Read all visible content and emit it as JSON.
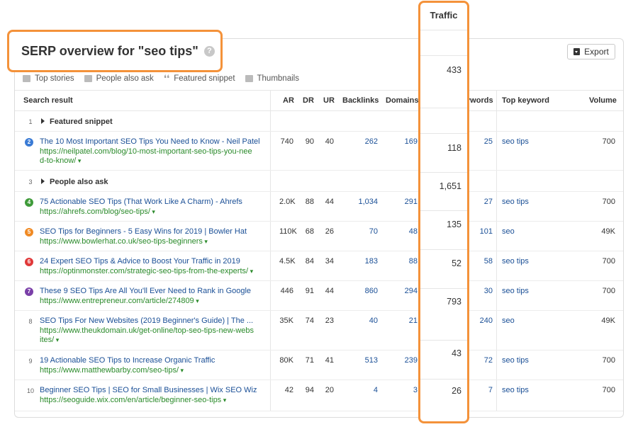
{
  "title": "SERP overview for \"seo tips\"",
  "help_icon": "?",
  "export_label": "Export",
  "filters": [
    "Top stories",
    "People also ask",
    "Featured snippet",
    "Thumbnails"
  ],
  "columns": {
    "search_result": "Search result",
    "ar": "AR",
    "dr": "DR",
    "ur": "UR",
    "backlinks": "Backlinks",
    "domains": "Domains",
    "keywords": "Keywords",
    "top_keyword": "Top keyword",
    "volume": "Volume"
  },
  "traffic_header": "Traffic",
  "sections": {
    "featured_rank": "1",
    "featured_label": "Featured snippet",
    "paa_rank": "3",
    "paa_label": "People also ask"
  },
  "rows": [
    {
      "rank": "2",
      "badge_color": "#3a7bd5",
      "title": "The 10 Most Important SEO Tips You Need to Know - Neil Patel",
      "url1": "https://neilpatel.com/blog/10-most-important-seo-tips-you-nee",
      "url2": "d-to-know/",
      "ar": "740",
      "dr": "90",
      "ur": "40",
      "backlinks": "262",
      "domains": "169",
      "traffic": "118",
      "keywords": "25",
      "top_keyword": "seo tips",
      "volume": "700"
    },
    {
      "rank": "4",
      "badge_color": "#3f9b3a",
      "title": "75 Actionable SEO Tips (That Work Like A Charm) - Ahrefs",
      "url1": "https://ahrefs.com/blog/seo-tips/",
      "url2": "",
      "ar": "2.0K",
      "dr": "88",
      "ur": "44",
      "backlinks": "1,034",
      "domains": "291",
      "traffic": "1,651",
      "keywords": "27",
      "top_keyword": "seo tips",
      "volume": "700"
    },
    {
      "rank": "5",
      "badge_color": "#f08a24",
      "title": "SEO Tips for Beginners - 5 Easy Wins for 2019 | Bowler Hat",
      "url1": "https://www.bowlerhat.co.uk/seo-tips-beginners",
      "url2": "",
      "ar": "110K",
      "dr": "68",
      "ur": "26",
      "backlinks": "70",
      "domains": "48",
      "traffic": "135",
      "keywords": "101",
      "top_keyword": "seo",
      "volume": "49K"
    },
    {
      "rank": "6",
      "badge_color": "#e0393a",
      "title": "24 Expert SEO Tips & Advice to Boost Your Traffic in 2019",
      "url1": "https://optinmonster.com/strategic-seo-tips-from-the-experts/",
      "url2": "",
      "ar": "4.5K",
      "dr": "84",
      "ur": "34",
      "backlinks": "183",
      "domains": "88",
      "traffic": "52",
      "keywords": "58",
      "top_keyword": "seo tips",
      "volume": "700"
    },
    {
      "rank": "7",
      "badge_color": "#7a3fa8",
      "title": "These 9 SEO Tips Are All You'll Ever Need to Rank in Google",
      "url1": "https://www.entrepreneur.com/article/274809",
      "url2": "",
      "ar": "446",
      "dr": "91",
      "ur": "44",
      "backlinks": "860",
      "domains": "294",
      "traffic": "793",
      "keywords": "30",
      "top_keyword": "seo tips",
      "volume": "700"
    },
    {
      "rank": "8",
      "badge_color": "",
      "title": "SEO Tips For New Websites (2019 Beginner's Guide) | The ...",
      "url1": "https://www.theukdomain.uk/get-online/top-seo-tips-new-webs",
      "url2": "ites/",
      "ar": "35K",
      "dr": "74",
      "ur": "23",
      "backlinks": "40",
      "domains": "21",
      "traffic": "43",
      "keywords": "240",
      "top_keyword": "seo",
      "volume": "49K"
    },
    {
      "rank": "9",
      "badge_color": "",
      "title": "19 Actionable SEO Tips to Increase Organic Traffic",
      "url1": "https://www.matthewbarby.com/seo-tips/",
      "url2": "",
      "ar": "80K",
      "dr": "71",
      "ur": "41",
      "backlinks": "513",
      "domains": "239",
      "traffic": "26",
      "keywords": "72",
      "top_keyword": "seo tips",
      "volume": "700"
    },
    {
      "rank": "10",
      "badge_color": "",
      "title": "Beginner SEO Tips | SEO for Small Businesses | Wix SEO Wiz",
      "url1": "https://seoguide.wix.com/en/article/beginner-seo-tips",
      "url2": "",
      "ar": "42",
      "dr": "94",
      "ur": "20",
      "backlinks": "4",
      "domains": "3",
      "traffic": "",
      "keywords": "7",
      "top_keyword": "seo tips",
      "volume": "700"
    }
  ],
  "traffic_values": [
    "433",
    "118",
    "1,651",
    "135",
    "52",
    "793",
    "43",
    "26"
  ]
}
